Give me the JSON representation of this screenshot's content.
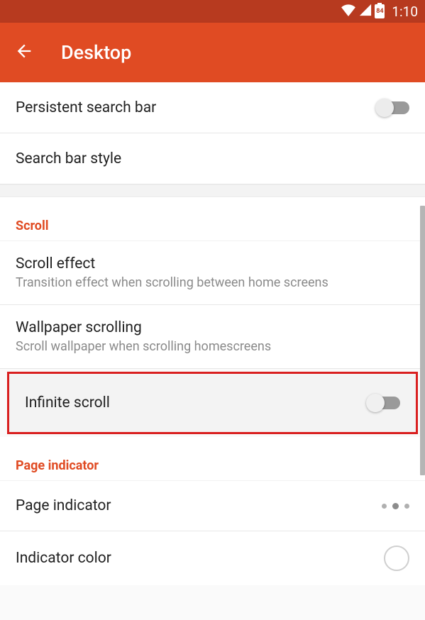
{
  "status": {
    "battery_pct": "84",
    "time": "1:10"
  },
  "appbar": {
    "title": "Desktop"
  },
  "rows": {
    "persistent_search": {
      "title": "Persistent search bar"
    },
    "search_bar_style": {
      "title": "Search bar style"
    }
  },
  "sections": {
    "scroll": {
      "header": "Scroll",
      "items": {
        "scroll_effect": {
          "title": "Scroll effect",
          "sub": "Transition effect when scrolling between home screens"
        },
        "wallpaper_scrolling": {
          "title": "Wallpaper scrolling",
          "sub": "Scroll wallpaper when scrolling homescreens"
        },
        "infinite_scroll": {
          "title": "Infinite scroll"
        }
      }
    },
    "page_indicator": {
      "header": "Page indicator",
      "items": {
        "page_indicator": {
          "title": "Page indicator"
        },
        "indicator_color": {
          "title": "Indicator color"
        }
      }
    }
  }
}
